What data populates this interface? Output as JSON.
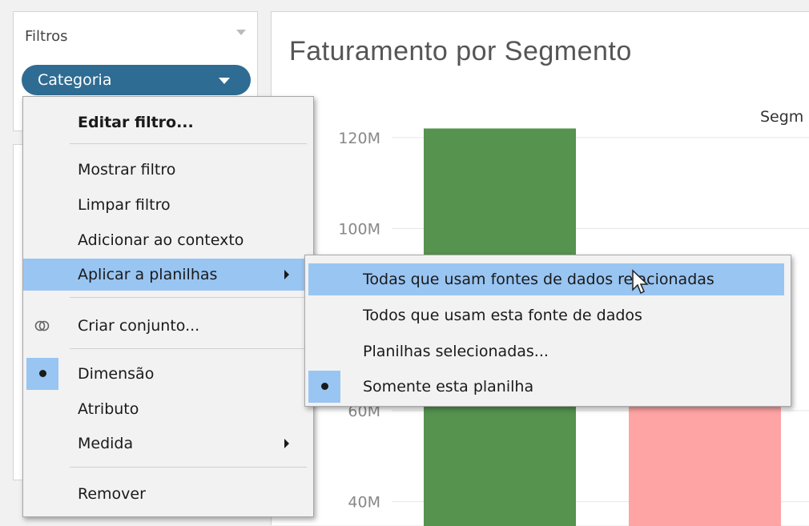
{
  "filters": {
    "title": "Filtros",
    "pill_label": "Categoria"
  },
  "chart": {
    "title": "Faturamento por Segmento",
    "legend_title": "Segm"
  },
  "chart_data": {
    "type": "bar",
    "title": "Faturamento por Segmento",
    "ytick_labels": [
      "120M",
      "100M",
      "60M",
      "40M"
    ],
    "yticks": [
      120,
      100,
      60,
      40
    ],
    "series": [
      {
        "values": [
          122,
          66
        ],
        "colors": [
          "#55934e",
          "#fea4a5"
        ]
      }
    ],
    "ylim": [
      35,
      130
    ],
    "grid": true
  },
  "context_menu": {
    "items": [
      {
        "label": "Editar filtro...",
        "bold": true
      },
      {
        "label": "Mostrar filtro"
      },
      {
        "label": "Limpar filtro"
      },
      {
        "label": "Adicionar ao contexto"
      },
      {
        "label": "Aplicar a planilhas",
        "submenu": true,
        "active": true
      },
      {
        "label": "Criar conjunto...",
        "icon": "set-icon"
      },
      {
        "label": "Dimensão",
        "checked": true
      },
      {
        "label": "Atributo"
      },
      {
        "label": "Medida",
        "submenu": true
      },
      {
        "label": "Remover"
      }
    ]
  },
  "submenu": {
    "items": [
      {
        "label": "Todas que usam fontes de dados relacionadas",
        "active": true
      },
      {
        "label": "Todos que usam esta fonte de dados"
      },
      {
        "label": "Planilhas selecionadas..."
      },
      {
        "label": "Somente esta planilha",
        "checked": true
      }
    ]
  },
  "colors": {
    "pill": "#2f6c93",
    "highlight": "#99c5f2",
    "bar_green": "#55934e",
    "bar_pink": "#fea4a5"
  }
}
